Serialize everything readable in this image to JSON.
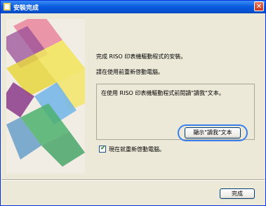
{
  "window": {
    "title": "安裝完成",
    "close": "✕"
  },
  "main": {
    "line1": "完成 RISO 印表機驅動程式的安裝。",
    "line2": "請在使用前重新啓動電腦。",
    "readme_text": "在使用 RISO 印表機驅動程式前閱讀\"讀我\"文本。",
    "readme_button": "顯示\"讀我\"文本",
    "restart_checkbox": {
      "checked": true,
      "mark": "✔",
      "label": "現在就重新啓動電腦。"
    }
  },
  "footer": {
    "finish_button": "完成"
  }
}
